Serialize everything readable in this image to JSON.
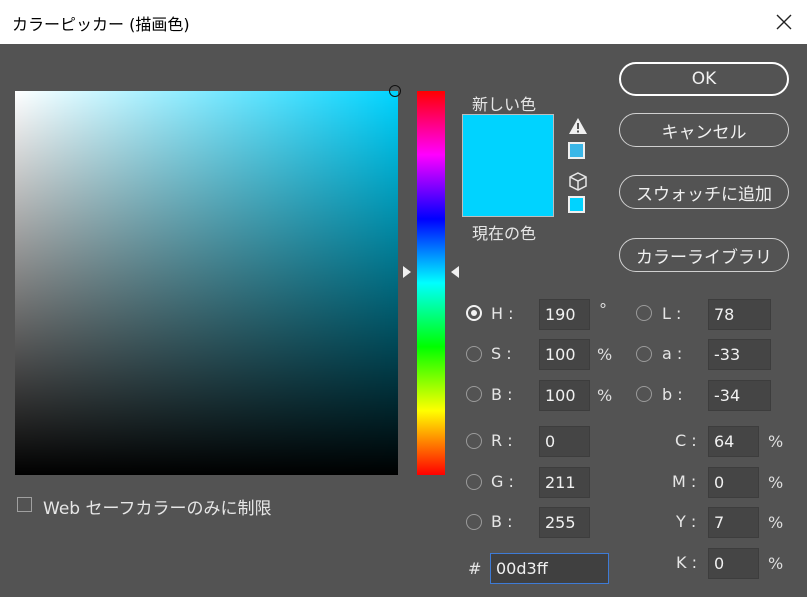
{
  "window": {
    "title": "カラーピッカー (描画色)"
  },
  "swatches": {
    "new_label": "新しい色",
    "current_label": "現在の色",
    "color": "#00d3ff"
  },
  "buttons": {
    "ok": "OK",
    "cancel": "キャンセル",
    "add_swatch": "スウォッチに追加",
    "color_library": "カラーライブラリ"
  },
  "hsb": {
    "h": {
      "label": "H :",
      "value": "190",
      "unit": "°"
    },
    "s": {
      "label": "S :",
      "value": "100",
      "unit": "%"
    },
    "b": {
      "label": "B :",
      "value": "100",
      "unit": "%"
    }
  },
  "rgb": {
    "r": {
      "label": "R :",
      "value": "0"
    },
    "g": {
      "label": "G :",
      "value": "211"
    },
    "b": {
      "label": "B :",
      "value": "255"
    }
  },
  "lab": {
    "l": {
      "label": "L :",
      "value": "78"
    },
    "a": {
      "label": "a :",
      "value": "-33"
    },
    "b": {
      "label": "b :",
      "value": "-34"
    }
  },
  "cmyk": {
    "c": {
      "label": "C :",
      "value": "64",
      "unit": "%"
    },
    "m": {
      "label": "M :",
      "value": "0",
      "unit": "%"
    },
    "y": {
      "label": "Y :",
      "value": "7",
      "unit": "%"
    },
    "k": {
      "label": "K :",
      "value": "0",
      "unit": "%"
    }
  },
  "hex": {
    "label": "#",
    "value": "00d3ff"
  },
  "web_safe": {
    "label": "Web セーフカラーのみに制限",
    "checked": false
  },
  "colors": {
    "background": "#535353",
    "hue_base": "#00d4ff",
    "hex_focus": "#3e7bd6",
    "gamut_swatch": "#3ab7e8"
  }
}
